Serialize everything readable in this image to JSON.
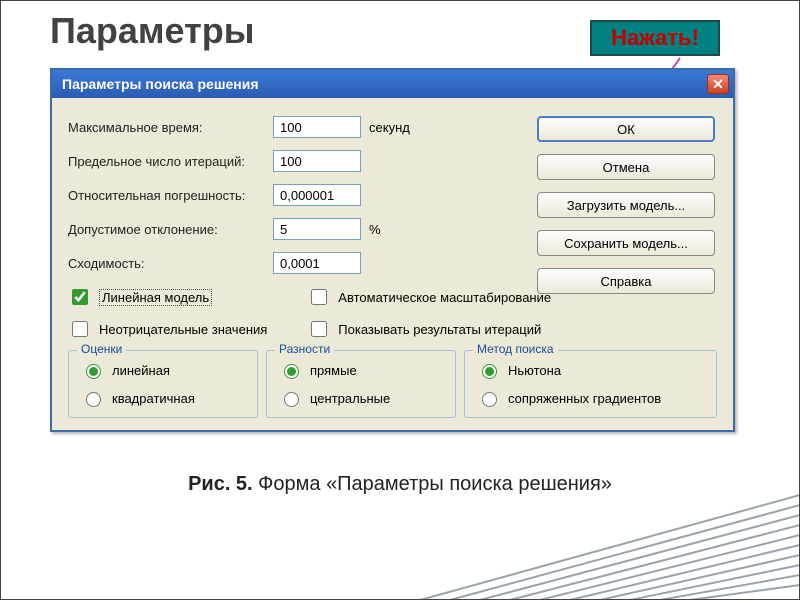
{
  "slide": {
    "title": "Параметры",
    "press": "Нажать!",
    "caption_label": "Рис. 5.",
    "caption_text": " Форма «Параметры поиска решения»"
  },
  "dialog": {
    "title": "Параметры поиска решения",
    "fields": {
      "max_time": {
        "label": "Максимальное время:",
        "value": "100",
        "unit": "секунд"
      },
      "iterations": {
        "label": "Предельное число итераций:",
        "value": "100",
        "unit": ""
      },
      "precision": {
        "label": "Относительная погрешность:",
        "value": "0,000001",
        "unit": ""
      },
      "tolerance": {
        "label": "Допустимое отклонение:",
        "value": "5",
        "unit": "%"
      },
      "convergence": {
        "label": "Сходимость:",
        "value": "0,0001",
        "unit": ""
      }
    },
    "buttons": {
      "ok": "ОК",
      "cancel": "Отмена",
      "load": "Загрузить модель...",
      "save": "Сохранить модель...",
      "help": "Справка"
    },
    "checks": {
      "linear": {
        "label": "Линейная модель",
        "checked": true
      },
      "nonneg": {
        "label": "Неотрицательные значения",
        "checked": false
      },
      "autoscale": {
        "label": "Автоматическое масштабирование",
        "checked": false
      },
      "show_iter": {
        "label": "Показывать результаты итераций",
        "checked": false
      }
    },
    "groups": {
      "estimates": {
        "legend": "Оценки",
        "linear": "линейная",
        "quadratic": "квадратичная",
        "selected": "linear"
      },
      "derivatives": {
        "legend": "Разности",
        "forward": "прямые",
        "central": "центральные",
        "selected": "forward"
      },
      "search": {
        "legend": "Метод поиска",
        "newton": "Ньютона",
        "conjugate": "сопряженных градиентов",
        "selected": "newton"
      }
    }
  }
}
